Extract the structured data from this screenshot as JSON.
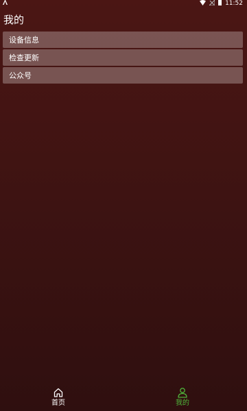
{
  "status_bar": {
    "left_icon": "android-notification-icon",
    "time": "11:52",
    "icons": [
      "wifi-icon",
      "signal-off-icon",
      "battery-icon"
    ]
  },
  "page": {
    "title": "我的"
  },
  "menu": {
    "items": [
      {
        "label": "设备信息"
      },
      {
        "label": "检查更新"
      },
      {
        "label": "公众号"
      }
    ]
  },
  "tabs": [
    {
      "label": "首页",
      "icon": "home-icon",
      "active": false
    },
    {
      "label": "我的",
      "icon": "person-icon",
      "active": true
    }
  ],
  "colors": {
    "background_top": "#4b1614",
    "background_bottom": "#2f0f0f",
    "active_tab": "#4fb43a",
    "inactive_tab": "#ffffff"
  }
}
